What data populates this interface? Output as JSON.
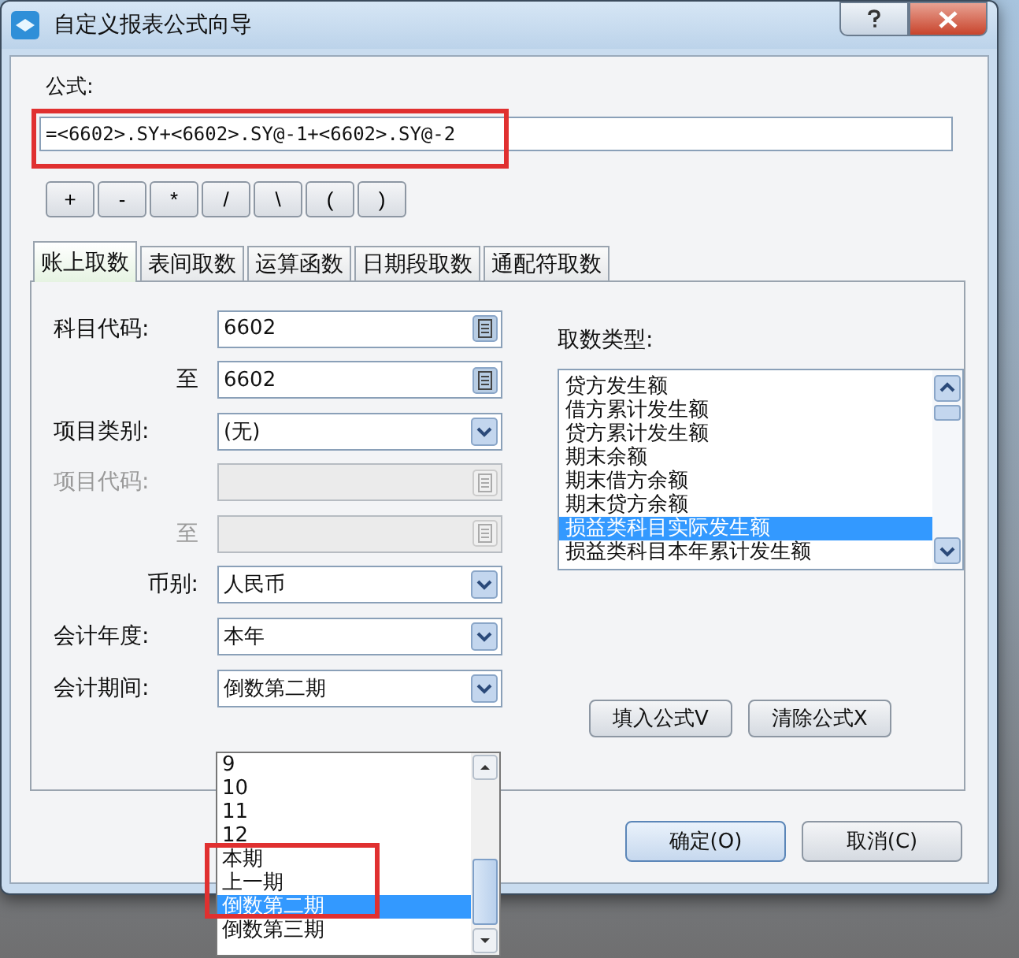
{
  "window": {
    "title": "自定义报表公式向导"
  },
  "formula": {
    "label": "公式:",
    "value": "=<6602>.SY+<6602>.SY@-1+<6602>.SY@-2"
  },
  "operators": [
    "+",
    "-",
    "*",
    "/",
    "\\",
    "(",
    ")"
  ],
  "tabs": [
    {
      "label": "账上取数",
      "selected": true
    },
    {
      "label": "表间取数",
      "selected": false
    },
    {
      "label": "运算函数",
      "selected": false
    },
    {
      "label": "日期段取数",
      "selected": false
    },
    {
      "label": "通配符取数",
      "selected": false
    }
  ],
  "fields": [
    {
      "kind": "picker",
      "label": "科目代码:",
      "value": "6602",
      "disabled": false,
      "sub": false
    },
    {
      "kind": "picker",
      "label": "至",
      "value": "6602",
      "disabled": false,
      "sub": true
    },
    {
      "kind": "select",
      "label": "项目类别:",
      "value": "(无)",
      "disabled": false,
      "sub": false
    },
    {
      "kind": "picker",
      "label": "项目代码:",
      "disabled": true,
      "sub": false
    },
    {
      "kind": "picker",
      "label": "至",
      "disabled": true,
      "sub": true
    },
    {
      "kind": "select",
      "label": "币别:",
      "value": "人民币",
      "disabled": false,
      "sub": true
    },
    {
      "kind": "select",
      "label": "会计年度:",
      "value": "本年",
      "disabled": false,
      "sub": false
    },
    {
      "kind": "select",
      "label": "会计期间:",
      "value": "倒数第二期",
      "disabled": false,
      "sub": false
    }
  ],
  "fetch_type": {
    "label": "取数类型:",
    "items": [
      {
        "label": "贷方发生额",
        "selected": false
      },
      {
        "label": "借方累计发生额",
        "selected": false
      },
      {
        "label": "贷方累计发生额",
        "selected": false
      },
      {
        "label": "期末余额",
        "selected": false
      },
      {
        "label": "期末借方余额",
        "selected": false
      },
      {
        "label": "期末贷方余额",
        "selected": false
      },
      {
        "label": "损益类科目实际发生额",
        "selected": true
      },
      {
        "label": "损益类科目本年累计发生额",
        "selected": false
      }
    ]
  },
  "action_buttons": [
    "填入公式V",
    "清除公式X"
  ],
  "footer_buttons": [
    "确定(O)",
    "取消(C)"
  ],
  "period_dropdown": {
    "items": [
      {
        "label": "9",
        "selected": false
      },
      {
        "label": "10",
        "selected": false
      },
      {
        "label": "11",
        "selected": false
      },
      {
        "label": "12",
        "selected": false
      },
      {
        "label": "本期",
        "selected": false
      },
      {
        "label": "上一期",
        "selected": false
      },
      {
        "label": "倒数第二期",
        "selected": true
      },
      {
        "label": "倒数第三期",
        "selected": false
      }
    ]
  }
}
